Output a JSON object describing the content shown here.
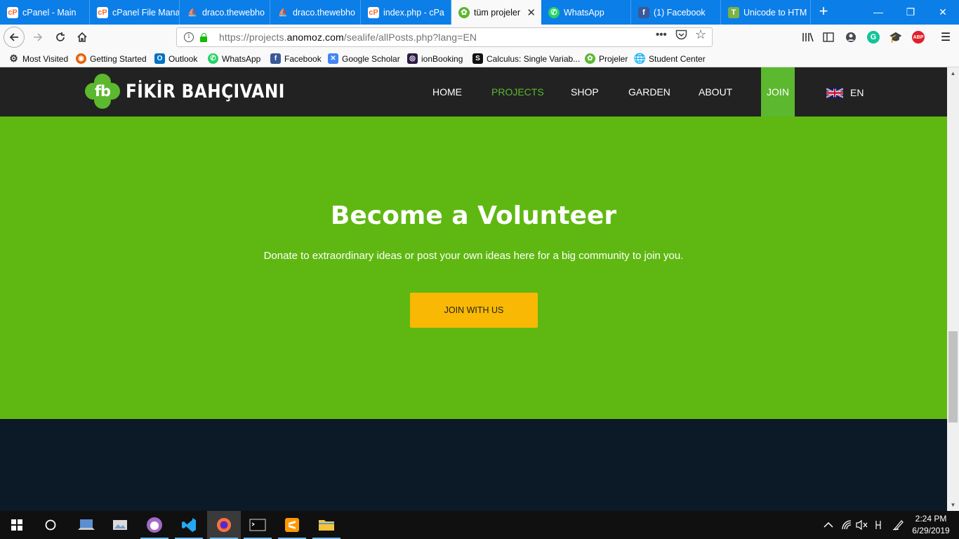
{
  "browser": {
    "tabs": [
      {
        "label": "cPanel - Main",
        "icon": "cpanel-icon"
      },
      {
        "label": "cPanel File Mana",
        "icon": "cpanel-icon"
      },
      {
        "label": "draco.thewebho",
        "icon": "sailboat-icon"
      },
      {
        "label": "draco.thewebho",
        "icon": "sailboat-icon"
      },
      {
        "label": "index.php - cPa",
        "icon": "cpanel-icon"
      },
      {
        "label": "tüm projeler",
        "icon": "gear-icon",
        "active": true
      },
      {
        "label": "WhatsApp",
        "icon": "whatsapp-icon"
      },
      {
        "label": "(1) Facebook",
        "icon": "facebook-icon"
      },
      {
        "label": "Unicode to HTM",
        "icon": "t-icon"
      }
    ],
    "new_tab_symbol": "+",
    "window_controls": {
      "minimize": "—",
      "restore": "❐",
      "close": "✕"
    },
    "url": {
      "prefix": "https://projects.",
      "domain": "anomoz.com",
      "path": "/sealife/allPosts.php?lang=EN"
    },
    "bookmarks": [
      {
        "label": "Most Visited",
        "icon": "gear-icon"
      },
      {
        "label": "Getting Started",
        "icon": "firefox-icon"
      },
      {
        "label": "Outlook",
        "icon": "outlook-icon"
      },
      {
        "label": "WhatsApp",
        "icon": "whatsapp-icon"
      },
      {
        "label": "Facebook",
        "icon": "facebook-icon"
      },
      {
        "label": "Google Scholar",
        "icon": "scholar-icon"
      },
      {
        "label": "ionBooking",
        "icon": "ion-icon"
      },
      {
        "label": "Calculus: Single Variab...",
        "icon": "s-icon"
      },
      {
        "label": "Projeler",
        "icon": "projeler-icon"
      },
      {
        "label": "Student Center",
        "icon": "globe-icon"
      }
    ]
  },
  "site": {
    "logo_mark": "fb",
    "brand": "FİKİR BAHÇIVANI",
    "menu": [
      {
        "label": "HOME"
      },
      {
        "label": "PROJECTS",
        "active": true
      },
      {
        "label": "SHOP"
      },
      {
        "label": "GARDEN"
      },
      {
        "label": "ABOUT"
      }
    ],
    "join_label": "JOIN",
    "language": "EN",
    "hero": {
      "title": "Become a Volunteer",
      "subtitle": "Donate to extraordinary ideas or post your own ideas here for a big community to join you.",
      "cta": "JOIN WITH US"
    }
  },
  "taskbar": {
    "time": "2:24 PM",
    "date": "6/29/2019"
  },
  "colors": {
    "brand_green": "#5cb82f",
    "hero_green": "#5fb811",
    "cta_yellow": "#f8b804",
    "header_dark": "#222222",
    "footer_dark": "#0c1926",
    "tabbar_blue": "#0b7ee8"
  }
}
